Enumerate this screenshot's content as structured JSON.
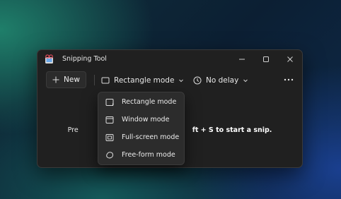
{
  "window": {
    "title": "Snipping Tool"
  },
  "toolbar": {
    "new_label": "New",
    "mode_label": "Rectangle mode",
    "delay_label": "No delay"
  },
  "hint": {
    "before": "Pre",
    "after": "ft + S to start a snip."
  },
  "mode_menu": {
    "items": [
      {
        "label": "Rectangle mode",
        "icon": "rectangle-snip-icon"
      },
      {
        "label": "Window mode",
        "icon": "window-snip-icon"
      },
      {
        "label": "Full-screen mode",
        "icon": "fullscreen-snip-icon"
      },
      {
        "label": "Free-form mode",
        "icon": "freeform-snip-icon"
      }
    ]
  },
  "colors": {
    "window_bg": "#202020",
    "menu_bg": "#2c2c2c",
    "text": "#e8e8e8"
  }
}
